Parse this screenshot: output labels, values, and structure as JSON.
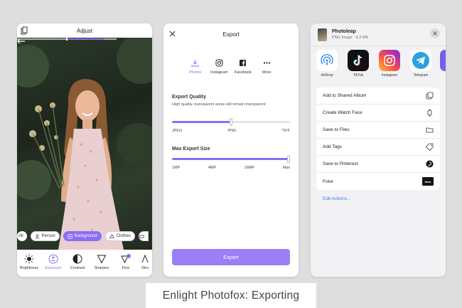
{
  "adjust_screen": {
    "title": "Adjust",
    "chips": [
      {
        "label": "All",
        "active": false
      },
      {
        "label": "Person",
        "active": false
      },
      {
        "label": "Background",
        "active": true
      },
      {
        "label": "Clothes",
        "active": false
      }
    ],
    "tools": [
      {
        "label": "Brightness",
        "icon": "sun-icon",
        "active": false
      },
      {
        "label": "Exposure",
        "icon": "exposure-icon",
        "active": true
      },
      {
        "label": "Contrast",
        "icon": "contrast-icon",
        "active": false
      },
      {
        "label": "Sharpen",
        "icon": "triangle-icon",
        "active": false
      },
      {
        "label": "Fine",
        "icon": "fine-icon",
        "active": false
      },
      {
        "label": "Stru",
        "icon": "structure-icon",
        "active": false
      }
    ],
    "slider_value": 0.5
  },
  "export_screen": {
    "title": "Export",
    "share_targets": [
      {
        "label": "Photos",
        "icon": "download-icon",
        "active": true
      },
      {
        "label": "Instagram",
        "icon": "instagram-icon",
        "active": false
      },
      {
        "label": "Facebook",
        "icon": "facebook-icon",
        "active": false
      },
      {
        "label": "More",
        "icon": "more-icon",
        "active": false
      }
    ],
    "quality": {
      "title": "Export Quality",
      "subtitle": "High quality, transparent areas will remain transparent",
      "ticks": [
        "JPEG",
        "PNG",
        "TIFF"
      ],
      "value": 0.5
    },
    "size": {
      "title": "Max Export Size",
      "ticks": [
        "1MP",
        "4MP",
        "16MP",
        "Max"
      ],
      "value": 1.0
    },
    "export_label": "Export"
  },
  "share_sheet": {
    "app_name": "Photoleap",
    "file_meta": "PNG Image · 4,3 MB",
    "apps": [
      {
        "label": "AirDrop",
        "icon": "airdrop-icon"
      },
      {
        "label": "TikTok",
        "icon": "tiktok-icon"
      },
      {
        "label": "Instagram",
        "icon": "instagram-app-icon"
      },
      {
        "label": "Telegram",
        "icon": "telegram-icon"
      }
    ],
    "actions": [
      {
        "label": "Add to Shared Album",
        "icon": "shared-album-icon"
      },
      {
        "label": "Create Watch Face",
        "icon": "watch-icon"
      },
      {
        "label": "Save to Files",
        "icon": "folder-icon"
      },
      {
        "label": "Add Tags",
        "icon": "tag-icon"
      },
      {
        "label": "Save to Pinterest",
        "icon": "pinterest-icon"
      },
      {
        "label": "Fotor",
        "icon": "fotor-icon"
      }
    ],
    "fotor_badge": "fotor",
    "edit_actions": "Edit Actions..."
  },
  "caption": "Enlight Photofox: Exporting",
  "colors": {
    "accent": "#8b6ef2",
    "link": "#3478f6",
    "background": "#dedede"
  }
}
